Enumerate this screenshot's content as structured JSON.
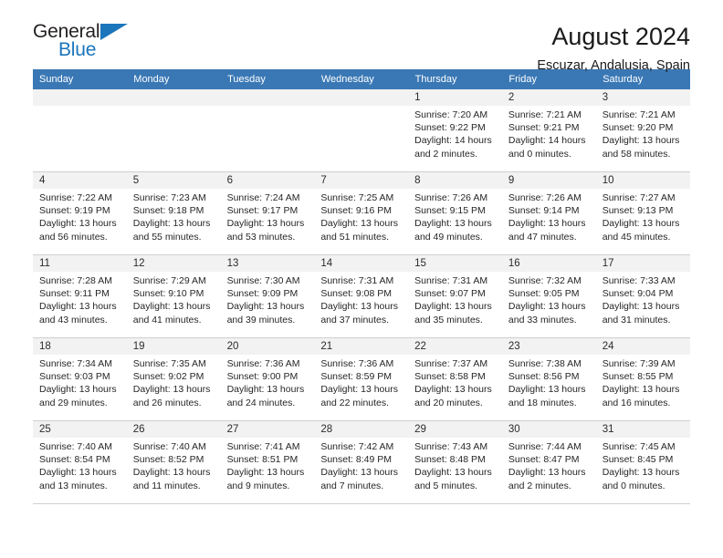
{
  "brand": {
    "name_top": "General",
    "name_bottom": "Blue",
    "accent_color": "#1b75bb"
  },
  "header": {
    "title": "August 2024",
    "subtitle": "Escuzar, Andalusia, Spain"
  },
  "calendar": {
    "header_bg": "#3a78b5",
    "daynum_bg": "#f2f2f2",
    "weekday_headers": [
      "Sunday",
      "Monday",
      "Tuesday",
      "Wednesday",
      "Thursday",
      "Friday",
      "Saturday"
    ],
    "weeks": [
      [
        {
          "day": "",
          "empty": true
        },
        {
          "day": "",
          "empty": true
        },
        {
          "day": "",
          "empty": true
        },
        {
          "day": "",
          "empty": true
        },
        {
          "day": "1",
          "sunrise": "Sunrise: 7:20 AM",
          "sunset": "Sunset: 9:22 PM",
          "daylight_1": "Daylight: 14 hours",
          "daylight_2": "and 2 minutes."
        },
        {
          "day": "2",
          "sunrise": "Sunrise: 7:21 AM",
          "sunset": "Sunset: 9:21 PM",
          "daylight_1": "Daylight: 14 hours",
          "daylight_2": "and 0 minutes."
        },
        {
          "day": "3",
          "sunrise": "Sunrise: 7:21 AM",
          "sunset": "Sunset: 9:20 PM",
          "daylight_1": "Daylight: 13 hours",
          "daylight_2": "and 58 minutes."
        }
      ],
      [
        {
          "day": "4",
          "sunrise": "Sunrise: 7:22 AM",
          "sunset": "Sunset: 9:19 PM",
          "daylight_1": "Daylight: 13 hours",
          "daylight_2": "and 56 minutes."
        },
        {
          "day": "5",
          "sunrise": "Sunrise: 7:23 AM",
          "sunset": "Sunset: 9:18 PM",
          "daylight_1": "Daylight: 13 hours",
          "daylight_2": "and 55 minutes."
        },
        {
          "day": "6",
          "sunrise": "Sunrise: 7:24 AM",
          "sunset": "Sunset: 9:17 PM",
          "daylight_1": "Daylight: 13 hours",
          "daylight_2": "and 53 minutes."
        },
        {
          "day": "7",
          "sunrise": "Sunrise: 7:25 AM",
          "sunset": "Sunset: 9:16 PM",
          "daylight_1": "Daylight: 13 hours",
          "daylight_2": "and 51 minutes."
        },
        {
          "day": "8",
          "sunrise": "Sunrise: 7:26 AM",
          "sunset": "Sunset: 9:15 PM",
          "daylight_1": "Daylight: 13 hours",
          "daylight_2": "and 49 minutes."
        },
        {
          "day": "9",
          "sunrise": "Sunrise: 7:26 AM",
          "sunset": "Sunset: 9:14 PM",
          "daylight_1": "Daylight: 13 hours",
          "daylight_2": "and 47 minutes."
        },
        {
          "day": "10",
          "sunrise": "Sunrise: 7:27 AM",
          "sunset": "Sunset: 9:13 PM",
          "daylight_1": "Daylight: 13 hours",
          "daylight_2": "and 45 minutes."
        }
      ],
      [
        {
          "day": "11",
          "sunrise": "Sunrise: 7:28 AM",
          "sunset": "Sunset: 9:11 PM",
          "daylight_1": "Daylight: 13 hours",
          "daylight_2": "and 43 minutes."
        },
        {
          "day": "12",
          "sunrise": "Sunrise: 7:29 AM",
          "sunset": "Sunset: 9:10 PM",
          "daylight_1": "Daylight: 13 hours",
          "daylight_2": "and 41 minutes."
        },
        {
          "day": "13",
          "sunrise": "Sunrise: 7:30 AM",
          "sunset": "Sunset: 9:09 PM",
          "daylight_1": "Daylight: 13 hours",
          "daylight_2": "and 39 minutes."
        },
        {
          "day": "14",
          "sunrise": "Sunrise: 7:31 AM",
          "sunset": "Sunset: 9:08 PM",
          "daylight_1": "Daylight: 13 hours",
          "daylight_2": "and 37 minutes."
        },
        {
          "day": "15",
          "sunrise": "Sunrise: 7:31 AM",
          "sunset": "Sunset: 9:07 PM",
          "daylight_1": "Daylight: 13 hours",
          "daylight_2": "and 35 minutes."
        },
        {
          "day": "16",
          "sunrise": "Sunrise: 7:32 AM",
          "sunset": "Sunset: 9:05 PM",
          "daylight_1": "Daylight: 13 hours",
          "daylight_2": "and 33 minutes."
        },
        {
          "day": "17",
          "sunrise": "Sunrise: 7:33 AM",
          "sunset": "Sunset: 9:04 PM",
          "daylight_1": "Daylight: 13 hours",
          "daylight_2": "and 31 minutes."
        }
      ],
      [
        {
          "day": "18",
          "sunrise": "Sunrise: 7:34 AM",
          "sunset": "Sunset: 9:03 PM",
          "daylight_1": "Daylight: 13 hours",
          "daylight_2": "and 29 minutes."
        },
        {
          "day": "19",
          "sunrise": "Sunrise: 7:35 AM",
          "sunset": "Sunset: 9:02 PM",
          "daylight_1": "Daylight: 13 hours",
          "daylight_2": "and 26 minutes."
        },
        {
          "day": "20",
          "sunrise": "Sunrise: 7:36 AM",
          "sunset": "Sunset: 9:00 PM",
          "daylight_1": "Daylight: 13 hours",
          "daylight_2": "and 24 minutes."
        },
        {
          "day": "21",
          "sunrise": "Sunrise: 7:36 AM",
          "sunset": "Sunset: 8:59 PM",
          "daylight_1": "Daylight: 13 hours",
          "daylight_2": "and 22 minutes."
        },
        {
          "day": "22",
          "sunrise": "Sunrise: 7:37 AM",
          "sunset": "Sunset: 8:58 PM",
          "daylight_1": "Daylight: 13 hours",
          "daylight_2": "and 20 minutes."
        },
        {
          "day": "23",
          "sunrise": "Sunrise: 7:38 AM",
          "sunset": "Sunset: 8:56 PM",
          "daylight_1": "Daylight: 13 hours",
          "daylight_2": "and 18 minutes."
        },
        {
          "day": "24",
          "sunrise": "Sunrise: 7:39 AM",
          "sunset": "Sunset: 8:55 PM",
          "daylight_1": "Daylight: 13 hours",
          "daylight_2": "and 16 minutes."
        }
      ],
      [
        {
          "day": "25",
          "sunrise": "Sunrise: 7:40 AM",
          "sunset": "Sunset: 8:54 PM",
          "daylight_1": "Daylight: 13 hours",
          "daylight_2": "and 13 minutes."
        },
        {
          "day": "26",
          "sunrise": "Sunrise: 7:40 AM",
          "sunset": "Sunset: 8:52 PM",
          "daylight_1": "Daylight: 13 hours",
          "daylight_2": "and 11 minutes."
        },
        {
          "day": "27",
          "sunrise": "Sunrise: 7:41 AM",
          "sunset": "Sunset: 8:51 PM",
          "daylight_1": "Daylight: 13 hours",
          "daylight_2": "and 9 minutes."
        },
        {
          "day": "28",
          "sunrise": "Sunrise: 7:42 AM",
          "sunset": "Sunset: 8:49 PM",
          "daylight_1": "Daylight: 13 hours",
          "daylight_2": "and 7 minutes."
        },
        {
          "day": "29",
          "sunrise": "Sunrise: 7:43 AM",
          "sunset": "Sunset: 8:48 PM",
          "daylight_1": "Daylight: 13 hours",
          "daylight_2": "and 5 minutes."
        },
        {
          "day": "30",
          "sunrise": "Sunrise: 7:44 AM",
          "sunset": "Sunset: 8:47 PM",
          "daylight_1": "Daylight: 13 hours",
          "daylight_2": "and 2 minutes."
        },
        {
          "day": "31",
          "sunrise": "Sunrise: 7:45 AM",
          "sunset": "Sunset: 8:45 PM",
          "daylight_1": "Daylight: 13 hours",
          "daylight_2": "and 0 minutes."
        }
      ]
    ]
  }
}
